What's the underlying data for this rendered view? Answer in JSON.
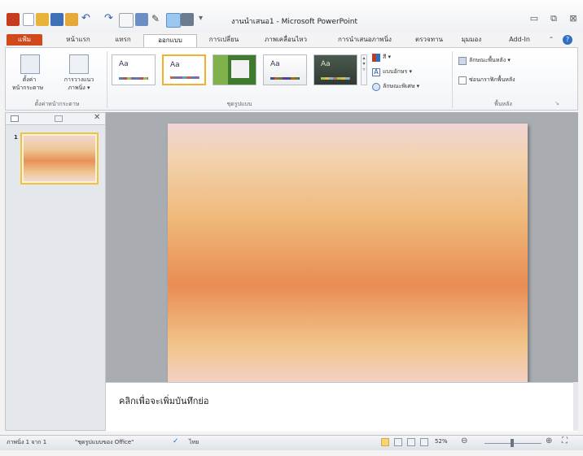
{
  "window": {
    "title": "งานนำเสนอ1 - Microsoft PowerPoint"
  },
  "tabs": {
    "file": "แฟ้ม",
    "items": [
      "หน้าแรก",
      "แทรก",
      "ออกแบบ",
      "การเปลี่ยน",
      "ภาพเคลื่อนไหว",
      "การนำเสนอภาพนิ่ง",
      "ตรวจทาน",
      "มุมมอง",
      "Add-In"
    ],
    "active": "ออกแบบ"
  },
  "ribbon": {
    "page_setup": {
      "btn1_line1": "ตั้งค่า",
      "btn1_line2": "หน้ากระดาษ",
      "btn2_line1": "การวางแนว",
      "btn2_line2": "ภาพนิ่ง ▾",
      "group_label": "ตั้งค่าหน้ากระดาษ"
    },
    "themes": {
      "sample": "Aa",
      "group_label": "ชุดรูปแบบ"
    },
    "theme_cmds": {
      "colors": "สี ▾",
      "fonts": "แบบอักษร ▾",
      "effects": "ลักษณะพิเศษ ▾"
    },
    "background": {
      "styles": "ลักษณะพื้นหลัง ▾",
      "hide": "ซ่อนกราฟิกพื้นหลัง",
      "group_label": "พื้นหลัง"
    }
  },
  "slides_panel": {
    "thumb_number": "1"
  },
  "notes": {
    "placeholder": "คลิกเพื่อจะเพิ่มบันทึกย่อ"
  },
  "status": {
    "slide_info": "ภาพนิ่ง 1 จาก 1",
    "theme": "\"ชุดรูปแบบของ Office\"",
    "language": "ไทย",
    "zoom": "52%"
  },
  "colors": {
    "file_tab": "#d04a1c",
    "selection": "#f2b02f",
    "slide_orange": "#e98c54"
  }
}
